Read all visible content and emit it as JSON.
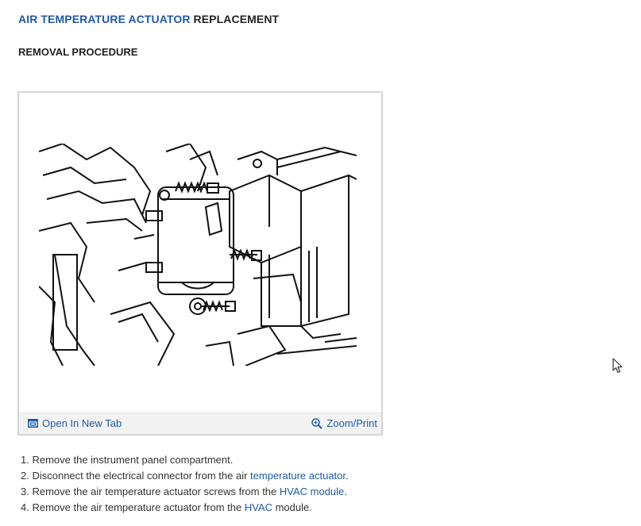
{
  "header": {
    "title_link": "AIR TEMPERATURE ACTUATOR",
    "title_rest": " REPLACEMENT",
    "subtitle": "REMOVAL PROCEDURE"
  },
  "figure": {
    "open_tab_label": "Open In New Tab",
    "zoom_label": "Zoom/Print",
    "open_tab_icon": "open-in-new-tab-icon",
    "zoom_icon": "zoom-icon"
  },
  "steps": [
    {
      "num": "1.",
      "pre": "Remove the instrument panel compartment.",
      "link": "",
      "post": ""
    },
    {
      "num": "2.",
      "pre": "Disconnect the electrical connector from the air ",
      "link": "temperature actuator",
      "post": "."
    },
    {
      "num": "3.",
      "pre": "Remove the air temperature actuator screws from the ",
      "link": "HVAC module",
      "post": "."
    },
    {
      "num": "4.",
      "pre": "Remove the air temperature actuator from the ",
      "link": "HVAC",
      "post": " module."
    }
  ],
  "colors": {
    "link": "#1f5aa6",
    "text": "#333333",
    "frame": "#d5d5d5",
    "bar": "#f2f2f2"
  }
}
